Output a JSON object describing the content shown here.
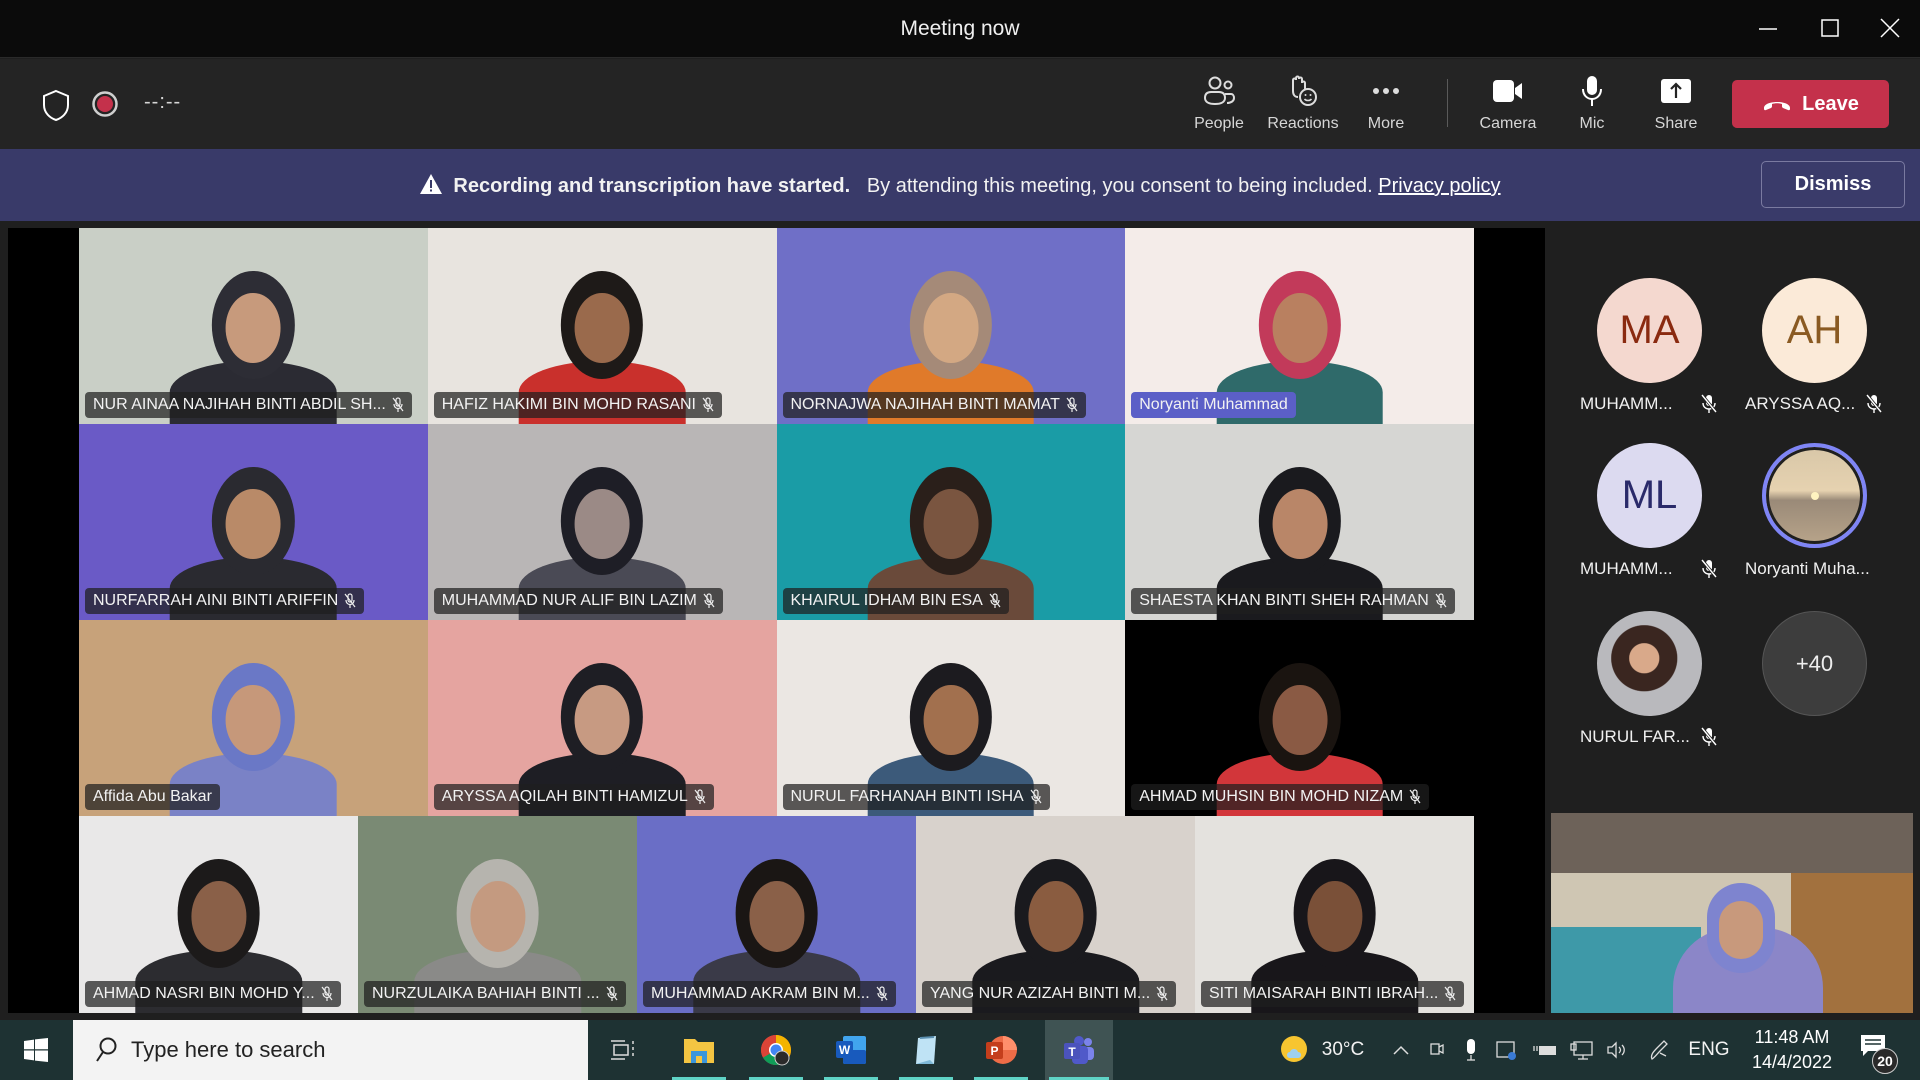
{
  "window": {
    "title": "Meeting now",
    "minimize_label": "Minimize",
    "maximize_label": "Maximize",
    "close_label": "Close"
  },
  "toolbar": {
    "timer": "--:--",
    "people_label": "People",
    "reactions_label": "Reactions",
    "more_label": "More",
    "camera_label": "Camera",
    "mic_label": "Mic",
    "share_label": "Share",
    "leave_label": "Leave",
    "leave_color": "#c4314b",
    "recording_color": "#c4314b"
  },
  "banner": {
    "bold_text": "Recording and transcription have started.",
    "text": "By attending this meeting, you consent to being included.",
    "link": "Privacy policy",
    "dismiss_label": "Dismiss",
    "background": "#393a69"
  },
  "grid": {
    "rows": [
      [
        {
          "name": "NUR AINAA NAJIHAH BINTI ABDIL SH...",
          "muted": true,
          "speaking": false,
          "bg": "#c9cfc6",
          "skin": "#c79a7c",
          "hijab": "#2d2d35",
          "shirt": "#2b2b33"
        },
        {
          "name": "HAFIZ HAKIMI BIN MOHD RASANI",
          "muted": true,
          "speaking": false,
          "bg": "#e8e4df",
          "skin": "#9a6a4c",
          "hijab": "#1e1a18",
          "shirt": "#c9302c"
        },
        {
          "name": "NORNAJWA NAJIHAH BINTI MAMAT",
          "muted": true,
          "speaking": false,
          "bg": "#6f6fc7",
          "skin": "#d3a883",
          "hijab": "#a58a78",
          "shirt": "#e07a2a"
        },
        {
          "name": "Noryanti Muhammad",
          "muted": false,
          "speaking": true,
          "bg": "#f4ece9",
          "skin": "#b98060",
          "hijab": "#c23a5a",
          "shirt": "#2f6a6a"
        }
      ],
      [
        {
          "name": "NURFARRAH AINI BINTI ARIFFIN",
          "muted": true,
          "speaking": false,
          "bg": "#6a5ac6",
          "skin": "#b98a68",
          "hijab": "#2a2a30",
          "shirt": "#2a2a30"
        },
        {
          "name": "MUHAMMAD NUR ALIF BIN LAZIM",
          "muted": true,
          "speaking": false,
          "bg": "#b9b6b6",
          "skin": "#9b8a86",
          "hijab": "#1e1e26",
          "shirt": "#4a4a55"
        },
        {
          "name": "KHAIRUL IDHAM BIN ESA",
          "muted": true,
          "speaking": false,
          "bg": "#1a9ca6",
          "skin": "#7a5540",
          "hijab": "#2a1f1a",
          "shirt": "#6a4a3a"
        },
        {
          "name": "SHAESTA KHAN BINTI SHEH RAHMAN",
          "muted": true,
          "speaking": false,
          "bg": "#d6d6d3",
          "skin": "#b98668",
          "hijab": "#1a1a1e",
          "shirt": "#1a1a1e"
        }
      ],
      [
        {
          "name": "Affida  Abu Bakar",
          "muted": false,
          "speaking": false,
          "bg": "#c7a27a",
          "skin": "#c6987a",
          "hijab": "#6a78c6",
          "shirt": "#7a82c6"
        },
        {
          "name": "ARYSSA AQILAH BINTI HAMIZUL",
          "muted": true,
          "speaking": false,
          "bg": "#e5a4a0",
          "skin": "#c79a82",
          "hijab": "#1e1e24",
          "shirt": "#1e1e24"
        },
        {
          "name": "NURUL FARHANAH BINTI ISHA",
          "muted": true,
          "speaking": false,
          "bg": "#ebe7e3",
          "skin": "#a2704e",
          "hijab": "#1c1b1f",
          "shirt": "#3c5a7a"
        },
        {
          "name": "AHMAD MUHSIN BIN MOHD NIZAM",
          "muted": true,
          "speaking": false,
          "bg": "#000000",
          "skin": "#8a5a44",
          "hijab": "#1a1410",
          "shirt": "#d2363a"
        }
      ],
      [
        {
          "name": "AHMAD NASRI BIN MOHD Y...",
          "muted": true,
          "speaking": false,
          "bg": "#e9e8e8",
          "skin": "#8a6048",
          "hijab": "#1c1a1a",
          "shirt": "#2c2c30"
        },
        {
          "name": "NURZULAIKA BAHIAH BINTI ...",
          "muted": true,
          "speaking": false,
          "bg": "#7a8a74",
          "skin": "#c49a80",
          "hijab": "#b6b4ae",
          "shirt": "#8a8a88"
        },
        {
          "name": "MUHAMMAD AKRAM BIN M...",
          "muted": true,
          "speaking": false,
          "bg": "#6a6ec6",
          "skin": "#8a6048",
          "hijab": "#1a1614",
          "shirt": "#3a3a48"
        },
        {
          "name": "YANG NUR AZIZAH BINTI M...",
          "muted": true,
          "speaking": false,
          "bg": "#d8d2cc",
          "skin": "#8a5c40",
          "hijab": "#1a1a1e",
          "shirt": "#1a1a1e"
        },
        {
          "name": "SITI MAISARAH BINTI IBRAH...",
          "muted": true,
          "speaking": false,
          "bg": "#e4e2de",
          "skin": "#7a5038",
          "hijab": "#18161a",
          "shirt": "#18161a"
        }
      ]
    ]
  },
  "roster": {
    "items": [
      {
        "initials": "MA",
        "name": "MUHAMM...",
        "muted": true,
        "bg": "#f4d8cf",
        "fg": "#8a2a10"
      },
      {
        "initials": "AH",
        "name": "ARYSSA AQ...",
        "muted": true,
        "bg": "#fbead8",
        "fg": "#8a5a22"
      },
      {
        "initials": "ML",
        "name": "MUHAMM...",
        "muted": true,
        "bg": "#dcdaf0",
        "fg": "#2a2a6a"
      },
      {
        "initials": "",
        "name": "Noryanti Muha...",
        "muted": false,
        "photo": "beach",
        "ring": "#7f85f5"
      },
      {
        "initials": "",
        "name": "NURUL FAR...",
        "muted": true,
        "photo": "portrait"
      }
    ],
    "overflow_label": "+40"
  },
  "taskbar": {
    "search_placeholder": "Type here to search",
    "apps": [
      "task-view",
      "file-explorer",
      "chrome",
      "word",
      "notepad",
      "powerpoint",
      "teams"
    ],
    "weather": "30°C",
    "language": "ENG",
    "time": "11:48 AM",
    "date": "14/4/2022",
    "notifications": "20"
  }
}
